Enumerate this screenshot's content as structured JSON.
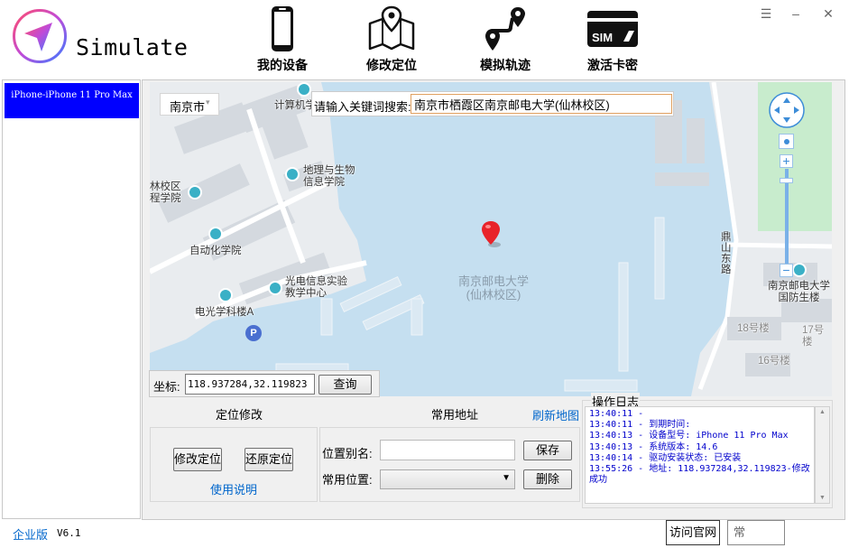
{
  "app": {
    "title": "Simulate"
  },
  "window": {
    "minimize": "–",
    "maximize": "☰",
    "close": "✕"
  },
  "nav": [
    {
      "label": "我的设备",
      "icon": "phone-icon"
    },
    {
      "label": "修改定位",
      "icon": "map-pin-icon"
    },
    {
      "label": "模拟轨迹",
      "icon": "route-icon"
    },
    {
      "label": "激活卡密",
      "icon": "sim-card-icon"
    }
  ],
  "sim_text": "SIM",
  "sidebar": {
    "devices": [
      "iPhone-iPhone 11 Pro Max"
    ]
  },
  "map": {
    "city": "南京市",
    "search_label": "请输入关键词搜索:",
    "search_value": "南京市栖霞区南京邮电大学(仙林校区)",
    "labels": {
      "computer": "计算机学",
      "geo": "地理与生物\n信息学院",
      "lin": "林校区\n程学院",
      "auto": "自动化学院",
      "opto": "光电信息实验\n教学中心",
      "elec": "电光学科楼A",
      "campus": "南京邮电大学\n(仙林校区)",
      "road": "鼎\n山\n东\n路",
      "defense": "南京邮电大学\n国防生楼",
      "b18": "18号楼",
      "b17": "17号楼",
      "b16": "16号楼",
      "parking": "P"
    },
    "coord_label": "坐标:",
    "coord_value": "118.937284,32.119823",
    "query_button": "查询"
  },
  "location_panel": {
    "title": "定位修改",
    "modify_button": "修改定位",
    "restore_button": "还原定位",
    "help_link": "使用说明"
  },
  "address_panel": {
    "title": "常用地址",
    "refresh_link": "刷新地图",
    "alias_label": "位置别名:",
    "alias_value": "",
    "save_button": "保存",
    "common_label": "常用位置:",
    "common_value": "",
    "delete_button": "删除"
  },
  "log": {
    "title": "操作日志",
    "lines": [
      "13:40:11 -",
      "13:40:11 - 到期时间:",
      "13:40:13 - 设备型号: iPhone 11 Pro Max",
      "13:40:13 - 系统版本: 14.6",
      "13:40:14 - 驱动安装状态: 已安装",
      "13:55:26 - 地址: 118.937284,32.119823-修改成功"
    ]
  },
  "footer": {
    "edition": "企业版",
    "version": "V6.1",
    "website_button": "访问官网",
    "partial_button": "常"
  }
}
